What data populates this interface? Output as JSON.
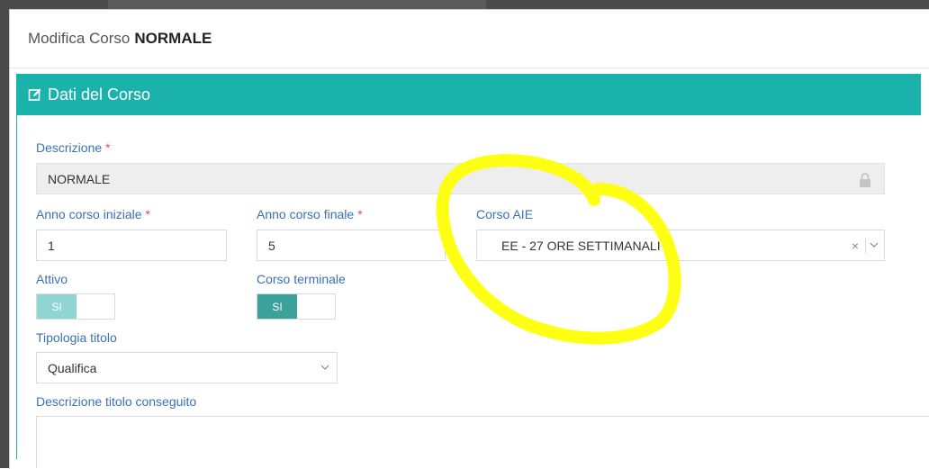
{
  "modal": {
    "title_prefix": "Modifica Corso",
    "title_name": "NORMALE"
  },
  "panel": {
    "heading": "Dati del Corso",
    "heading_icon": "edit-icon"
  },
  "fields": {
    "descrizione": {
      "label": "Descrizione",
      "required": "*",
      "value": "NORMALE",
      "icon": "lock-icon"
    },
    "anno_iniziale": {
      "label": "Anno corso iniziale",
      "required": "*",
      "value": "1"
    },
    "anno_finale": {
      "label": "Anno corso finale",
      "required": "*",
      "value": "5"
    },
    "corso_aie": {
      "label": "Corso AIE",
      "value": "EE - 27 ORE SETTIMANALI",
      "clear": "×"
    },
    "attivo": {
      "label": "Attivo",
      "toggle_text": "SI"
    },
    "corso_terminale": {
      "label": "Corso terminale",
      "toggle_text": "SI"
    },
    "tipologia_titolo": {
      "label": "Tipologia titolo",
      "value": "Qualifica"
    },
    "descrizione_titolo": {
      "label": "Descrizione titolo conseguito",
      "value": ""
    }
  },
  "colors": {
    "accent": "#1cb2ac",
    "label": "#3a71b4",
    "required": "#d9534f",
    "highlight": "#ffff00"
  }
}
